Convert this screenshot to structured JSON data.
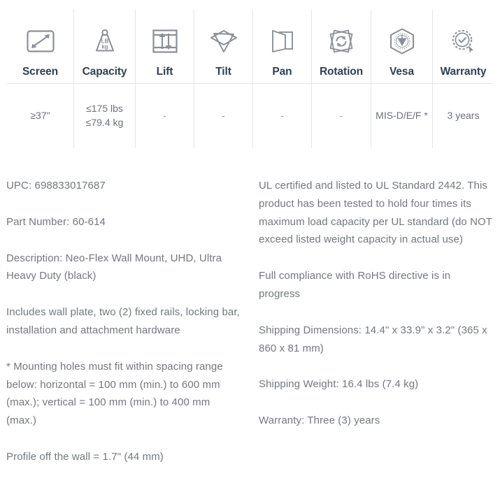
{
  "spec_table": {
    "columns": [
      {
        "key": "screen",
        "icon": "screen-size-icon",
        "label": "Screen",
        "value": "≥37\""
      },
      {
        "key": "capacity",
        "icon": "weight-icon",
        "label": "Capacity",
        "value": "≤175 lbs\n≤79.4 kg",
        "icon_text_top": "LB",
        "icon_text_bottom": "kg"
      },
      {
        "key": "lift",
        "icon": "lift-icon",
        "label": "Lift",
        "value": "-"
      },
      {
        "key": "tilt",
        "icon": "tilt-icon",
        "label": "Tilt",
        "value": "-"
      },
      {
        "key": "pan",
        "icon": "pan-icon",
        "label": "Pan",
        "value": "-"
      },
      {
        "key": "rotation",
        "icon": "rotation-icon",
        "label": "Rotation",
        "value": "-"
      },
      {
        "key": "vesa",
        "icon": "vesa-badge-icon",
        "label": "Vesa",
        "value": "MIS-D/E/F *"
      },
      {
        "key": "warranty",
        "icon": "warranty-seal-icon",
        "label": "Warranty",
        "value": "3 years"
      }
    ]
  },
  "details": {
    "left_column": [
      "UPC: 698833017687",
      "Part Number: 60-614",
      "Description: Neo-Flex Wall Mount, UHD, Ultra Heavy Duty (black)",
      "Includes wall plate, two (2) fixed rails, locking bar, installation and attachment hardware",
      "* Mounting holes must fit within spacing range below: horizontal = 100 mm (min.) to 600 mm (max.); vertical = 100 mm (min.) to 400 mm (max.)",
      "Profile off the wall = 1.7\" (44 mm)"
    ],
    "right_column": [
      "UL certified and listed to UL Standard 2442. This product has been tested to hold four times its maximum load capacity per UL standard (do NOT exceed listed weight capacity in actual use)",
      "Full compliance with RoHS directive is in progress",
      "Shipping Dimensions: 14.4\" x 33.9\" x 3.2\" (365 x 860 x 81 mm)",
      "Shipping Weight: 16.4 lbs (7.4 kg)",
      "Warranty: Three (3) years"
    ]
  },
  "colors": {
    "border": "#e3e5e8",
    "header_text": "#2f4054",
    "body_text": "#72787f",
    "icon_stroke": "#8a9097"
  }
}
